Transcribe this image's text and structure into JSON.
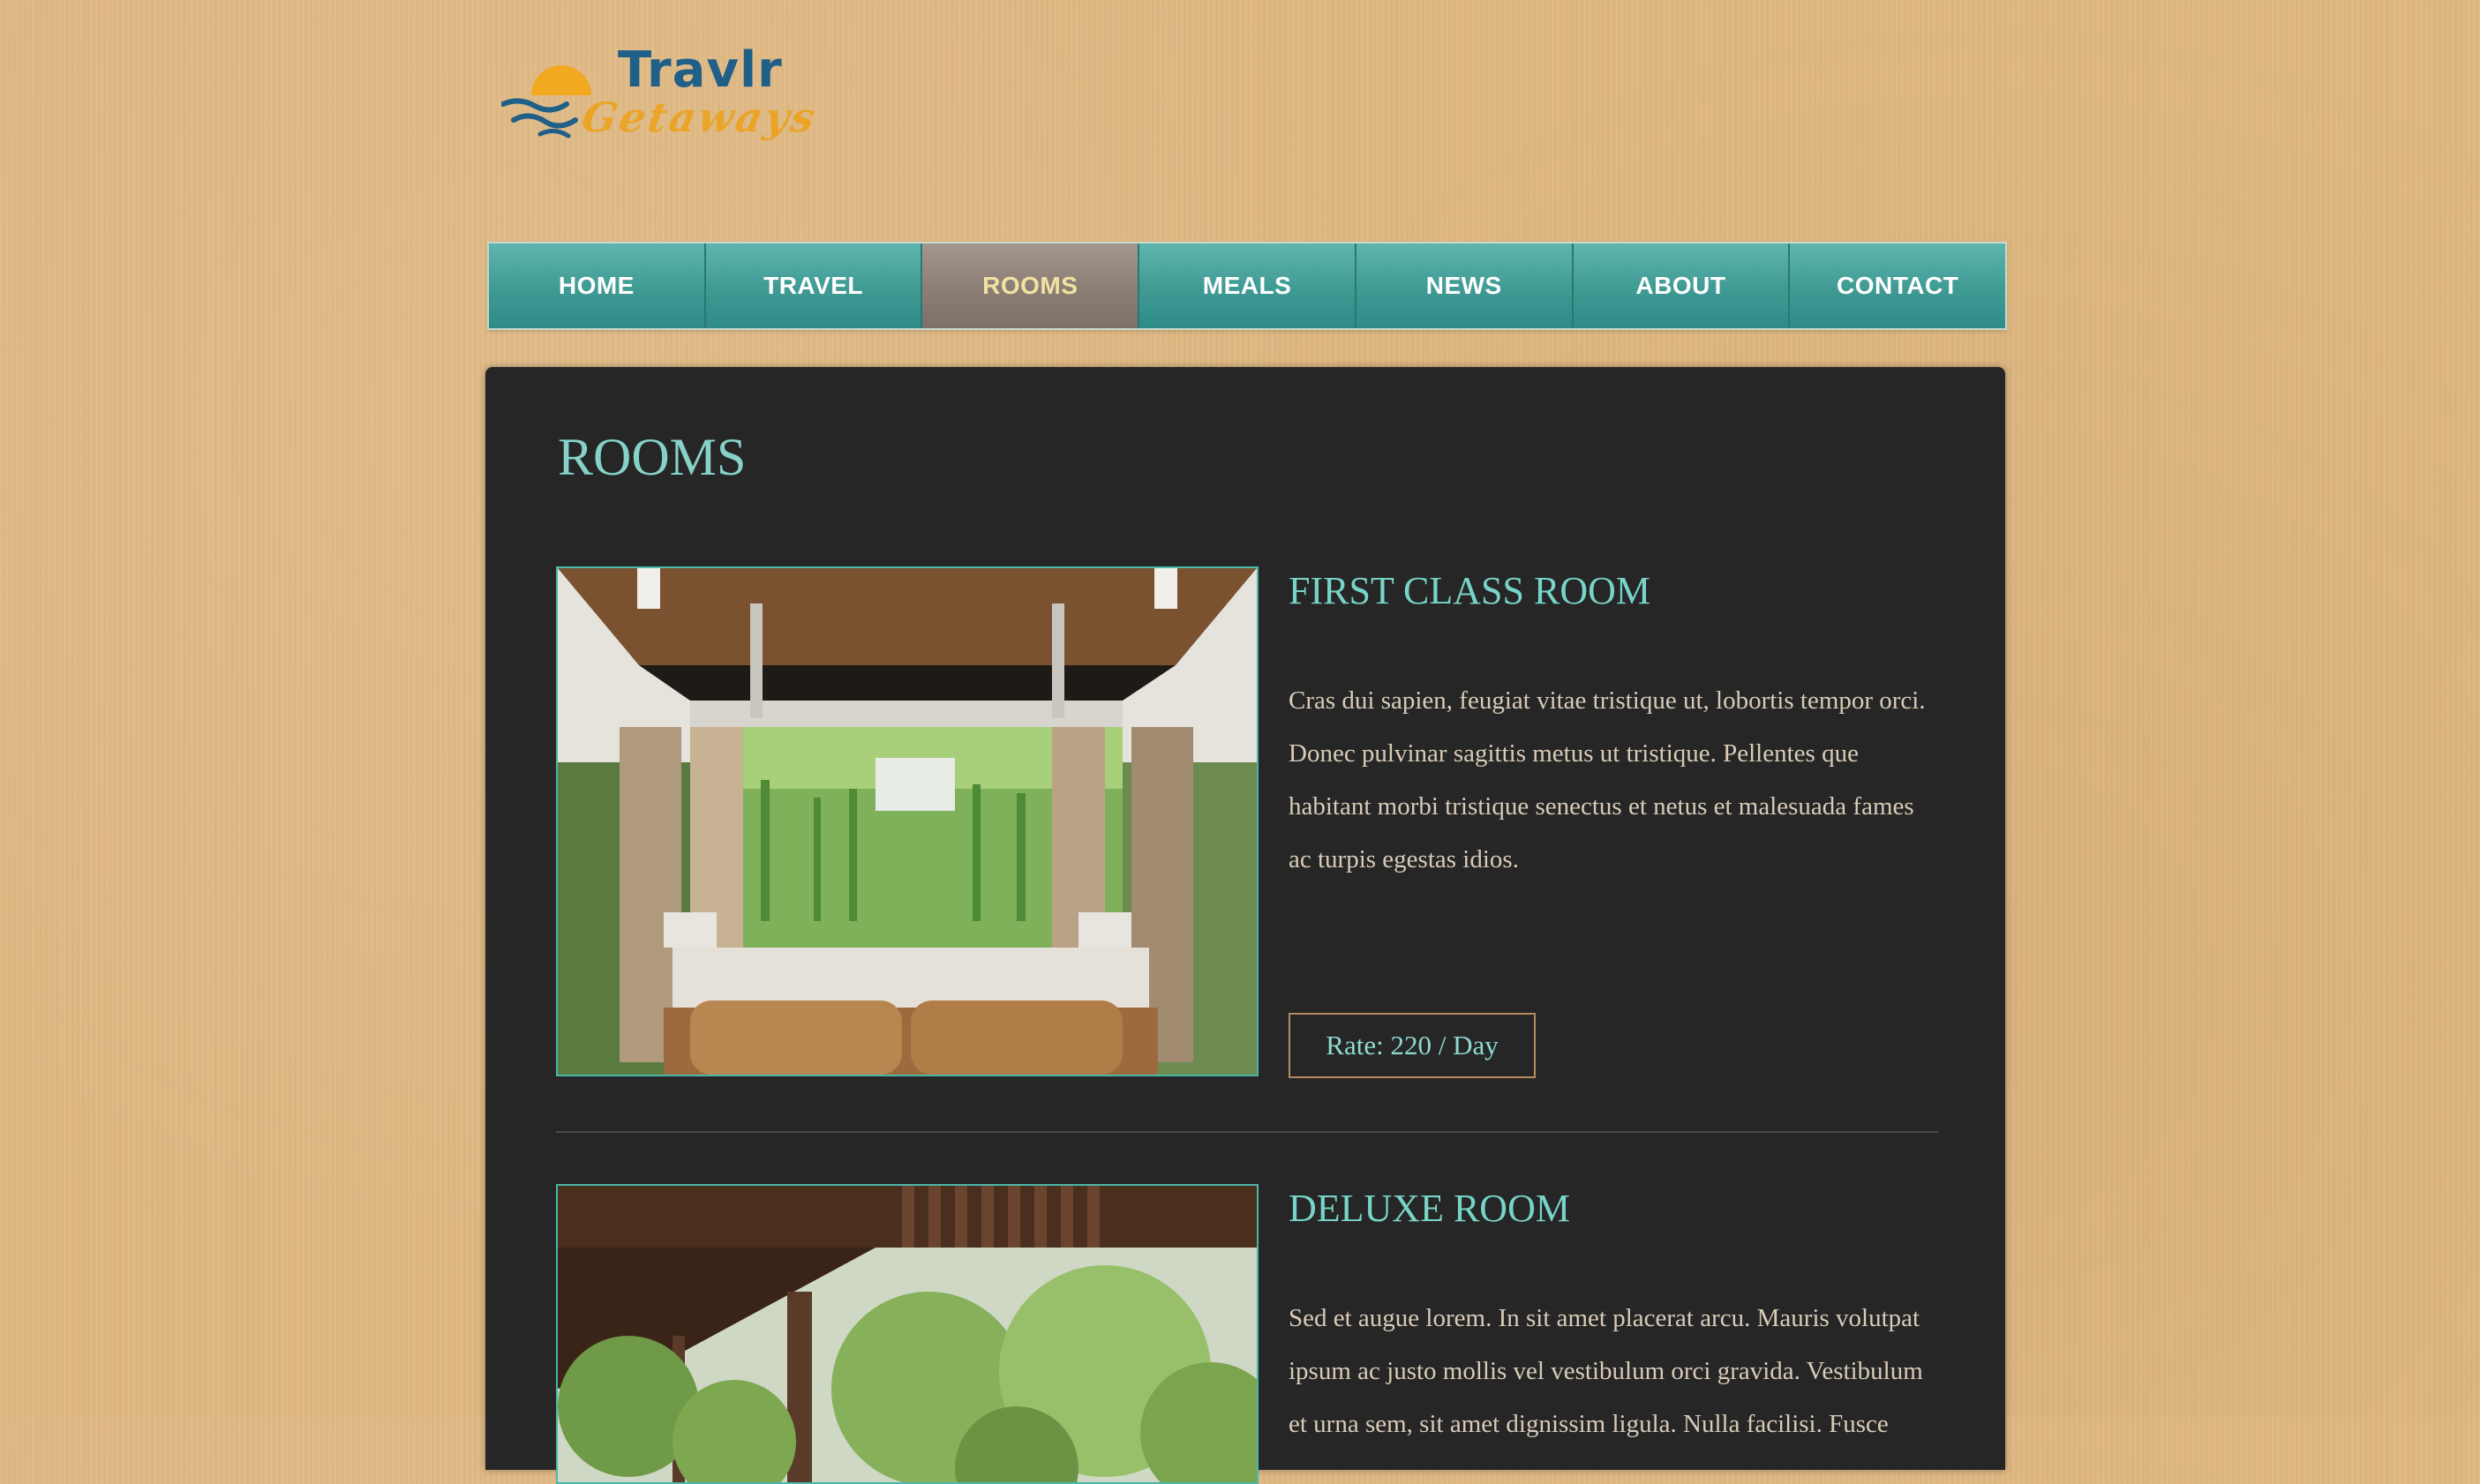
{
  "brand": {
    "line1": "Travlr",
    "line2": "Getaways"
  },
  "nav": {
    "items": [
      {
        "label": "HOME"
      },
      {
        "label": "TRAVEL"
      },
      {
        "label": "ROOMS",
        "active": true
      },
      {
        "label": "MEALS"
      },
      {
        "label": "NEWS"
      },
      {
        "label": "ABOUT"
      },
      {
        "label": "CONTACT"
      }
    ]
  },
  "page": {
    "title": "ROOMS"
  },
  "rooms": [
    {
      "title": "FIRST CLASS ROOM",
      "description": "Cras dui sapien, feugiat vitae tristique ut, lobortis tempor orci. Donec pulvinar sagittis metus ut tristique. Pellentes que habitant morbi tristique senectus et netus et malesuada fames ac turpis egestas idios.",
      "rate": "Rate: 220 / Day"
    },
    {
      "title": "DELUXE ROOM",
      "description": "Sed et augue lorem. In sit amet placerat arcu. Mauris volutpat ipsum ac justo mollis vel vestibulum orci gravida. Vestibulum et urna sem, sit amet dignissim ligula. Nulla facilisi. Fusce"
    }
  ],
  "colors": {
    "background": "#dfb882",
    "nav": "#3f9a94",
    "nav_active": "#8b7e75",
    "panel": "#262626",
    "accent": "#78d4c8"
  }
}
